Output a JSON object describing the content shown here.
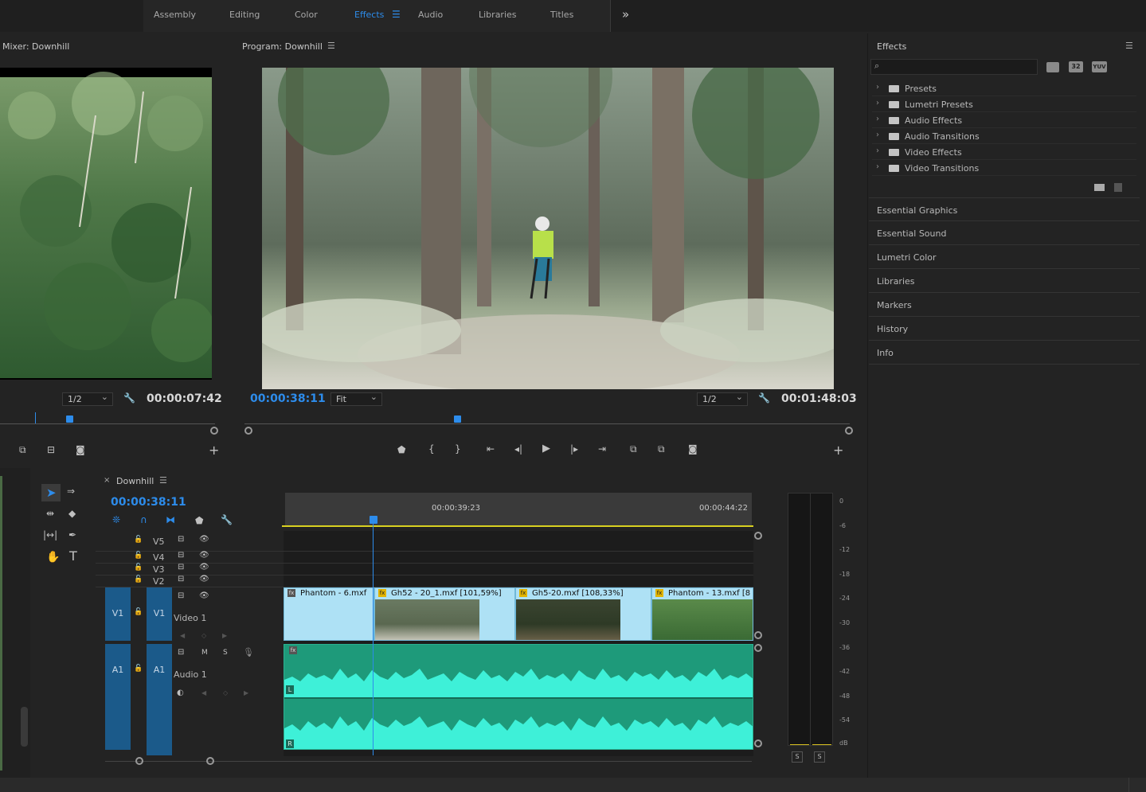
{
  "workspaces": [
    {
      "label": "Assembly",
      "active": false
    },
    {
      "label": "Editing",
      "active": false
    },
    {
      "label": "Color",
      "active": false
    },
    {
      "label": "Effects",
      "active": true
    },
    {
      "label": "Audio",
      "active": false
    },
    {
      "label": "Libraries",
      "active": false
    },
    {
      "label": "Titles",
      "active": false
    }
  ],
  "source_monitor": {
    "title": "Mixer: Downhill",
    "resolution": "1/2",
    "timecode": "00:00:07:42"
  },
  "program_monitor": {
    "title": "Program: Downhill",
    "current_time": "00:00:38:11",
    "zoom": "Fit",
    "resolution": "1/2",
    "duration": "00:01:48:03"
  },
  "effects_panel": {
    "title": "Effects",
    "search_placeholder": "",
    "filters": [
      "32",
      "YUV"
    ],
    "items": [
      "Presets",
      "Lumetri Presets",
      "Audio Effects",
      "Audio Transitions",
      "Video Effects",
      "Video Transitions"
    ],
    "sections": [
      "Essential Graphics",
      "Essential Sound",
      "Lumetri Color",
      "Libraries",
      "Markers",
      "History",
      "Info"
    ]
  },
  "timeline": {
    "sequence": "Downhill",
    "current_time": "00:00:38:11",
    "ruler": [
      "00:00:39:23",
      "00:00:44:22"
    ],
    "tracks": {
      "video": [
        "V5",
        "V4",
        "V3",
        "V2"
      ],
      "v1_src": "V1",
      "v1": "V1",
      "v1_name": "Video 1",
      "a1_src": "A1",
      "a1": "A1",
      "a1_name": "Audio 1",
      "m": "M",
      "s": "S"
    },
    "clips": [
      "Phantom - 6.mxf",
      "Gh52 - 20_1.mxf [101,59%]",
      "Gh5-20.mxf [108,33%]",
      "Phantom - 13.mxf [8"
    ],
    "channels": [
      "L",
      "R"
    ]
  },
  "meter": {
    "scale": [
      "0",
      "-6",
      "-12",
      "-18",
      "-24",
      "-30",
      "-36",
      "-42",
      "-48",
      "-54",
      "dB"
    ],
    "solo": [
      "S",
      "S"
    ]
  }
}
